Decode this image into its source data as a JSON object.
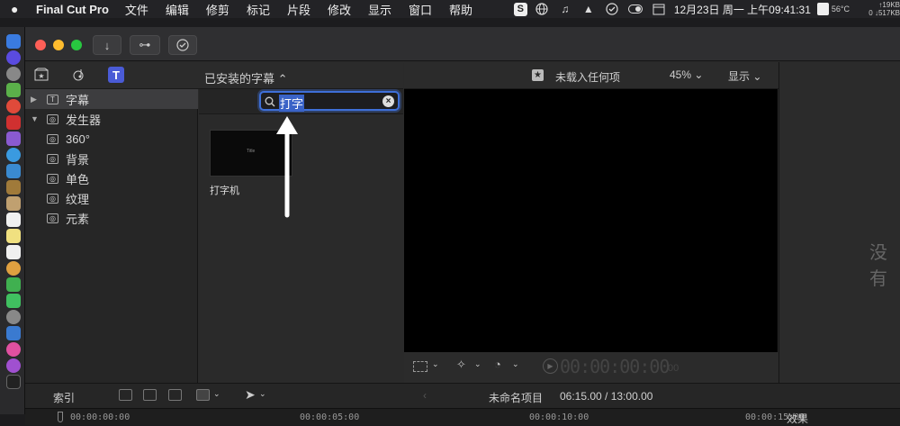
{
  "menubar": {
    "apple": "",
    "app_name": "Final Cut Pro",
    "menus": [
      "文件",
      "编辑",
      "修剪",
      "标记",
      "片段",
      "修改",
      "显示",
      "窗口",
      "帮助"
    ],
    "datetime": "12月23日 周一 上午09:41:31",
    "temp": "56°C",
    "net_up": "↑19KB",
    "net_down": "0 ↓517KB"
  },
  "browser": {
    "title": "已安装的字幕 ⌃",
    "search_value": "打字",
    "clip_label": "打字机",
    "thumb_text": "Title"
  },
  "sidebar": {
    "items": [
      {
        "label": "字幕",
        "icon": "T"
      },
      {
        "label": "发生器",
        "icon": ""
      },
      {
        "label": "360°",
        "icon": ""
      },
      {
        "label": "背景",
        "icon": ""
      },
      {
        "label": "单色",
        "icon": ""
      },
      {
        "label": "纹理",
        "icon": ""
      },
      {
        "label": "元素",
        "icon": ""
      }
    ]
  },
  "viewer": {
    "title": "未载入任何项",
    "zoom": "45% ⌄",
    "display": "显示 ⌄",
    "timecode": "00:00:00:00",
    "timecode_small": "00"
  },
  "inspector": {
    "placeholder": "没有"
  },
  "timeline": {
    "index_label": "索引",
    "project_name": "未命名项目",
    "duration": "06:15.00 / 13:00.00",
    "effects_label": "效果",
    "ruler": [
      "00:00:00:00",
      "00:00:05:00",
      "00:00:10:00",
      "00:00:15:00"
    ]
  }
}
